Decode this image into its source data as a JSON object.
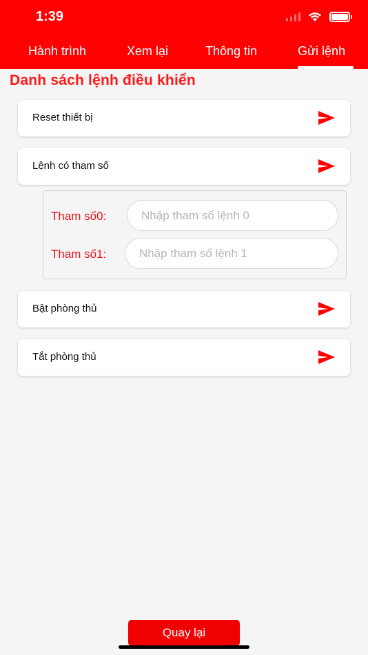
{
  "status_bar": {
    "time": "1:39"
  },
  "tabs": [
    {
      "label": "Hành trình"
    },
    {
      "label": "Xem lại"
    },
    {
      "label": "Thông tin"
    },
    {
      "label": "Gửi lệnh"
    }
  ],
  "section_title": "Danh sách lệnh điều khiển",
  "commands": [
    {
      "label": "Reset thiết bị"
    },
    {
      "label": "Lệnh có tham số"
    },
    {
      "label": "Bật phòng thủ"
    },
    {
      "label": "Tắt phòng thủ"
    }
  ],
  "params": [
    {
      "label": "Tham số0:",
      "placeholder": "Nhập tham số lệnh 0",
      "value": ""
    },
    {
      "label": "Tham số1:",
      "placeholder": "Nhập tham số lệnh 1",
      "value": ""
    }
  ],
  "back_button": "Quay lại",
  "colors": {
    "accent": "#ff0000",
    "label_red": "#e8131b",
    "background": "#f5f5f5"
  },
  "icons": {
    "send": "send-icon",
    "wifi": "wifi-icon",
    "battery": "battery-icon",
    "signal": "cellular-signal-icon"
  }
}
